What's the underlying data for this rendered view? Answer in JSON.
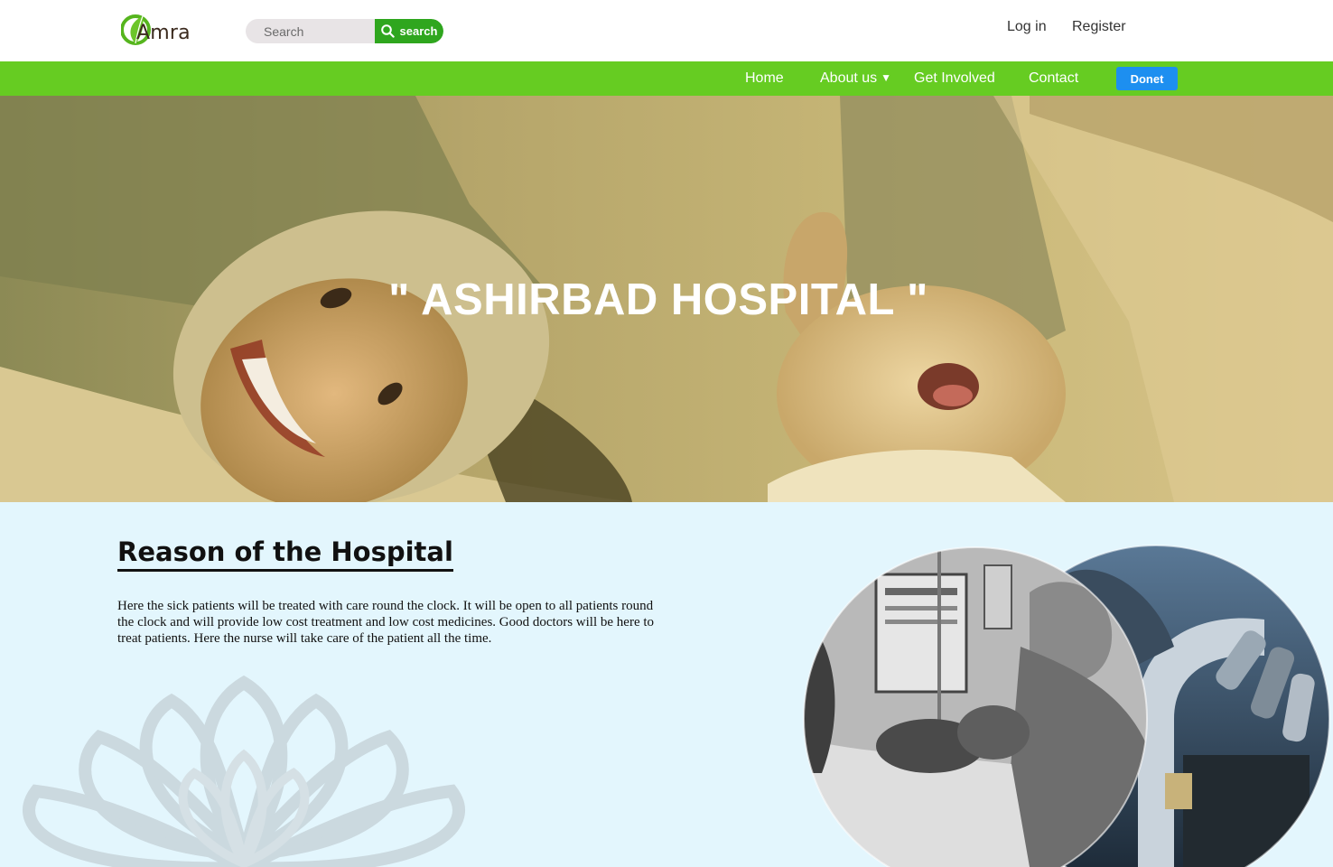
{
  "header": {
    "logo_text": "Amra",
    "search": {
      "placeholder": "Search",
      "button_label": "search"
    },
    "login_label": "Log in",
    "register_label": "Register"
  },
  "nav": {
    "items": [
      {
        "label": "Home"
      },
      {
        "label": "About us",
        "has_dropdown": true
      },
      {
        "label": "Get Involved"
      },
      {
        "label": "Contact"
      }
    ],
    "donate_label": "Donet"
  },
  "hero": {
    "title": "\" ASHIRBAD HOSPITAL \""
  },
  "reason": {
    "title": "Reason of the Hospital",
    "body": "Here the sick patients will be treated with care round the clock. It will be open to all patients round the clock and will provide low cost treatment and low cost medicines. Good doctors will be here to treat patients. Here the nurse will take care of the patient all the time."
  },
  "colors": {
    "nav_green": "#66cc22",
    "search_green": "#2fa61e",
    "donate_blue": "#1d8ff0",
    "content_bg": "#e3f6fd"
  },
  "icons": {
    "logo": "leaf-logo-icon",
    "search": "search-icon",
    "dropdown": "caret-down-icon"
  }
}
